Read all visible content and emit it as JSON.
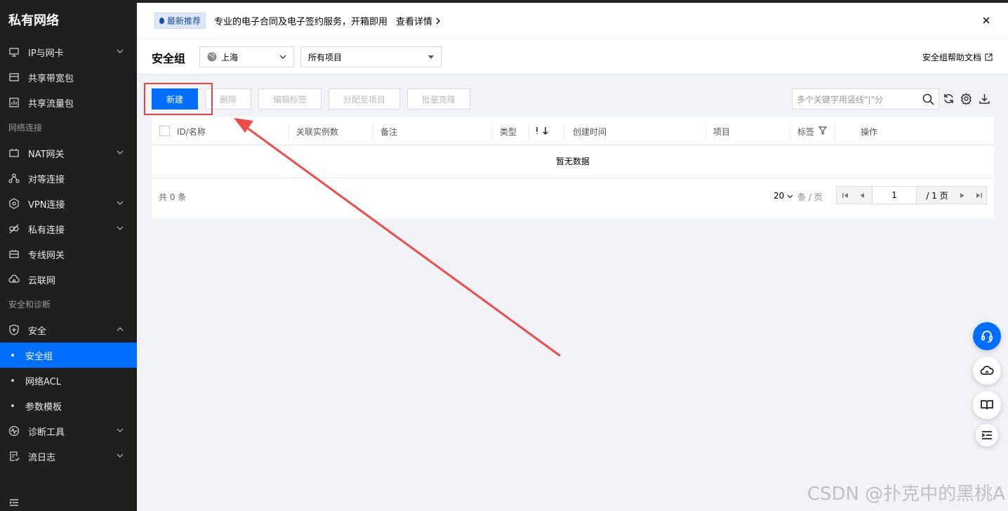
{
  "sidebar": {
    "title": "私有网络",
    "items_top": [
      {
        "label": "IP与网卡",
        "icon": "ip-icon",
        "expandable": true
      },
      {
        "label": "共享带宽包",
        "icon": "bandwidth-icon",
        "expandable": false
      },
      {
        "label": "共享流量包",
        "icon": "traffic-icon",
        "expandable": false
      }
    ],
    "group_network": "网络连接",
    "items_network": [
      {
        "label": "NAT网关",
        "icon": "nat-icon",
        "expandable": true
      },
      {
        "label": "对等连接",
        "icon": "peering-icon",
        "expandable": false
      },
      {
        "label": "VPN连接",
        "icon": "vpn-icon",
        "expandable": true
      },
      {
        "label": "私有连接",
        "icon": "private-link-icon",
        "expandable": true
      },
      {
        "label": "专线网关",
        "icon": "dc-gateway-icon",
        "expandable": false
      },
      {
        "label": "云联网",
        "icon": "ccn-icon",
        "expandable": false
      }
    ],
    "group_security": "安全和诊断",
    "security": {
      "label": "安全",
      "icon": "shield-icon"
    },
    "security_sub": [
      "安全组",
      "网络ACL",
      "参数模板"
    ],
    "active_sub": "安全组",
    "items_bottom": [
      {
        "label": "诊断工具",
        "icon": "diagnose-icon",
        "expandable": true
      },
      {
        "label": "流日志",
        "icon": "flowlog-icon",
        "expandable": true
      }
    ]
  },
  "banner": {
    "badge": "最新推荐",
    "text": "专业的电子合同及电子签约服务，开箱即用",
    "link": "查看详情"
  },
  "header": {
    "title": "安全组",
    "region": "上海",
    "project": "所有项目",
    "help": "安全组帮助文档"
  },
  "toolbar": {
    "new": "新建",
    "delete": "删除",
    "edit_tags": "编辑标签",
    "assign_project": "分配至项目",
    "batch_clone": "批量克隆",
    "search_placeholder": "多个关键字用竖线\"|\"分"
  },
  "table": {
    "columns": [
      "ID/名称",
      "关联实例数",
      "备注",
      "类型",
      "创建时间",
      "项目",
      "标签",
      "操作"
    ],
    "empty": "暂无数据"
  },
  "pagination": {
    "total": "共 0 条",
    "page_size": "20",
    "per_page": "条 / 页",
    "current": "1",
    "pages": "/ 1 页"
  },
  "watermark": "CSDN @扑克中的黑桃A",
  "colors": {
    "primary": "#006eff",
    "highlight": "#e54545",
    "sidebar": "#1f1f1f"
  }
}
